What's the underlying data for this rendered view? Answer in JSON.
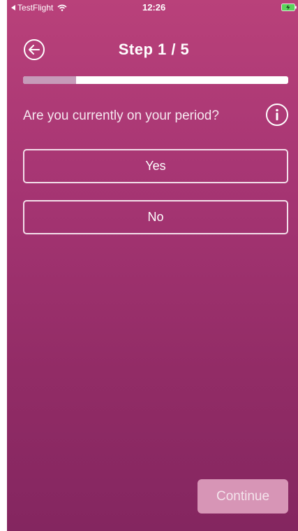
{
  "status_bar": {
    "back_app": "TestFlight",
    "time": "12:26"
  },
  "header": {
    "title": "Step 1 / 5"
  },
  "progress": {
    "fraction": 0.2
  },
  "question": {
    "text": "Are you currently on your period?"
  },
  "options": [
    {
      "label": "Yes"
    },
    {
      "label": "No"
    }
  ],
  "footer": {
    "continue_label": "Continue"
  },
  "colors": {
    "background_top": "#b9417a",
    "background_bottom": "#842660",
    "progress_fill": "#c69ab9",
    "continue_bg": "#d795b6",
    "battery": "#5ad35a"
  }
}
